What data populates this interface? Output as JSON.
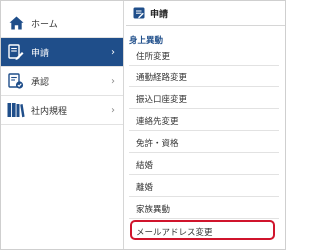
{
  "sidebar": {
    "items": [
      {
        "label": "ホーム",
        "icon": "home-icon",
        "active": false
      },
      {
        "label": "申請",
        "icon": "application-form-icon",
        "active": true
      },
      {
        "label": "承認",
        "icon": "approval-stamp-icon",
        "active": false
      },
      {
        "label": "社内規程",
        "icon": "books-icon",
        "active": false
      }
    ],
    "chevron": "›"
  },
  "panel": {
    "title": "申請",
    "section": "身上異動",
    "items": [
      "住所変更",
      "通勤経路変更",
      "振込口座変更",
      "連絡先変更",
      "免許・資格",
      "結婚",
      "離婚",
      "家族異動",
      "メールアドレス変更"
    ],
    "highlighted_item": "メールアドレス変更"
  },
  "colors": {
    "active_bg": "#1f4e8a",
    "section_text": "#1f4e8a",
    "highlight_border": "#d0142c",
    "icon_blue": "#1f4e8a"
  }
}
